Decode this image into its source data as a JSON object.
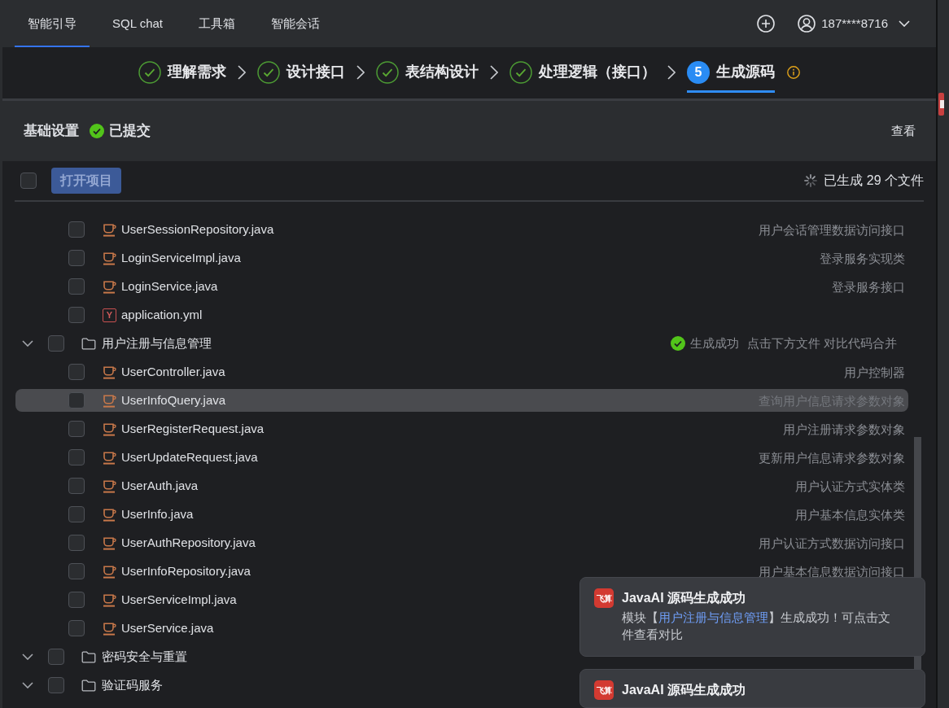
{
  "nav": {
    "tabs": [
      {
        "label": "智能引导",
        "selected": true
      },
      {
        "label": "SQL chat",
        "selected": false
      },
      {
        "label": "工具箱",
        "selected": false
      },
      {
        "label": "智能会话",
        "selected": false
      }
    ],
    "account": "187****8716"
  },
  "steps": [
    {
      "label": "理解需求",
      "done": true,
      "selected": false
    },
    {
      "label": "设计接口",
      "done": true,
      "selected": false
    },
    {
      "label": "表结构设计",
      "done": true,
      "selected": false
    },
    {
      "label": "处理逻辑（接口）",
      "done": true,
      "selected": false
    },
    {
      "label": "生成源码",
      "number": "5",
      "done": false,
      "selected": true
    }
  ],
  "settings_panel": {
    "title": "基础设置",
    "submitted": true,
    "status": "已提交",
    "action": "查看"
  },
  "file_list": {
    "select_all": {
      "checked": false
    },
    "open_button": {
      "label": "打开项目",
      "disabled": true
    },
    "generating": true,
    "progress": "已生成 29 个文件",
    "continued_files": [
      {
        "name": "UserSessionRepository.java",
        "kind": "java",
        "description": "用户会话管理数据访问接口",
        "checked": false,
        "selected": false
      },
      {
        "name": "LoginServiceImpl.java",
        "kind": "java",
        "description": "登录服务实现类",
        "checked": false,
        "selected": false
      },
      {
        "name": "LoginService.java",
        "kind": "java",
        "description": "登录服务接口",
        "checked": false,
        "selected": false
      },
      {
        "name": "application.yml",
        "kind": "yml",
        "icon_letter": "Y",
        "checked": false,
        "selected": false
      }
    ],
    "folders": [
      {
        "name": "用户注册与信息管理",
        "expanded": true,
        "checked": false,
        "status": {
          "kind": "success",
          "text": "生成成功",
          "hint": "点击下方文件 对比代码合并"
        },
        "children": [
          {
            "name": "UserController.java",
            "kind": "java",
            "description": "用户控制器",
            "checked": false,
            "selected": false
          },
          {
            "name": "UserInfoQuery.java",
            "kind": "java",
            "description": "查询用户信息请求参数对象",
            "checked": false,
            "selected": true
          },
          {
            "name": "UserRegisterRequest.java",
            "kind": "java",
            "description": "用户注册请求参数对象",
            "checked": false,
            "selected": false
          },
          {
            "name": "UserUpdateRequest.java",
            "kind": "java",
            "description": "更新用户信息请求参数对象",
            "checked": false,
            "selected": false
          },
          {
            "name": "UserAuth.java",
            "kind": "java",
            "description": "用户认证方式实体类",
            "checked": false,
            "selected": false
          },
          {
            "name": "UserInfo.java",
            "kind": "java",
            "description": "用户基本信息实体类",
            "checked": false,
            "selected": false
          },
          {
            "name": "UserAuthRepository.java",
            "kind": "java",
            "description": "用户认证方式数据访问接口",
            "checked": false,
            "selected": false
          },
          {
            "name": "UserInfoRepository.java",
            "kind": "java",
            "description": "用户基本信息数据访问接口",
            "checked": false,
            "selected": false
          },
          {
            "name": "UserServiceImpl.java",
            "kind": "java",
            "checked": false,
            "selected": false
          },
          {
            "name": "UserService.java",
            "kind": "java",
            "checked": false,
            "selected": false
          }
        ]
      },
      {
        "name": "密码安全与重置",
        "expanded": true,
        "checked": false
      },
      {
        "name": "验证码服务",
        "expanded": true,
        "checked": false
      }
    ]
  },
  "notifications": [
    {
      "logo": "飞算",
      "title": "JavaAI 源码生成成功",
      "message": {
        "before": "模块【",
        "link": "用户注册与信息管理",
        "after": "】生成成功！可点击文件查看对比"
      }
    },
    {
      "logo": "飞算",
      "title": "JavaAI 源码生成成功"
    }
  ]
}
